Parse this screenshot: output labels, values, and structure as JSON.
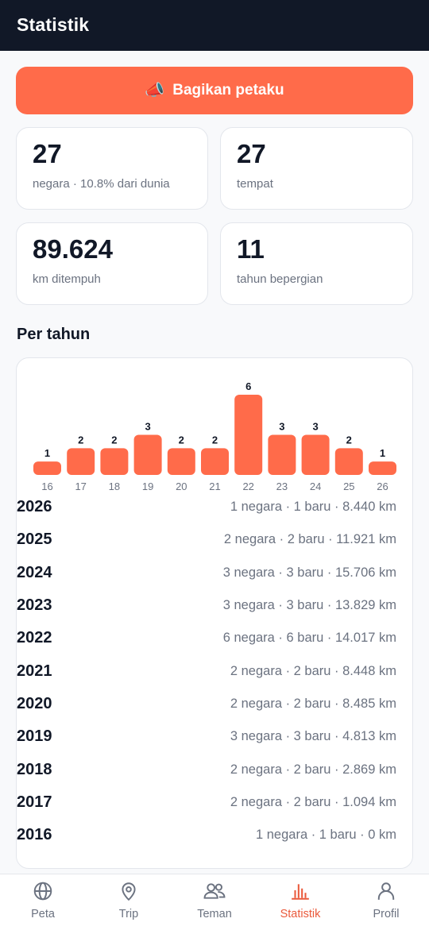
{
  "header": {
    "title": "Statistik"
  },
  "share_button": {
    "icon": "megaphone-icon",
    "label": "Bagikan petaku"
  },
  "stats": [
    {
      "value": "27",
      "label": "negara · 10.8% dari dunia"
    },
    {
      "value": "27",
      "label": "tempat"
    },
    {
      "value": "89.624",
      "label": "km ditempuh"
    },
    {
      "value": "11",
      "label": "tahun bepergian"
    }
  ],
  "per_year": {
    "title": "Per tahun",
    "rows": [
      {
        "year": "2026",
        "info": "1 negara · 1 baru · 8.440 km"
      },
      {
        "year": "2025",
        "info": "2 negara · 2 baru · 11.921 km"
      },
      {
        "year": "2024",
        "info": "3 negara · 3 baru · 15.706 km"
      },
      {
        "year": "2023",
        "info": "3 negara · 3 baru · 13.829 km"
      },
      {
        "year": "2022",
        "info": "6 negara · 6 baru · 14.017 km"
      },
      {
        "year": "2021",
        "info": "2 negara · 2 baru · 8.448 km"
      },
      {
        "year": "2020",
        "info": "2 negara · 2 baru · 8.485 km"
      },
      {
        "year": "2019",
        "info": "3 negara · 3 baru · 4.813 km"
      },
      {
        "year": "2018",
        "info": "2 negara · 2 baru · 2.869 km"
      },
      {
        "year": "2017",
        "info": "2 negara · 2 baru · 1.094 km"
      },
      {
        "year": "2016",
        "info": "1 negara · 1 baru · 0 km"
      }
    ]
  },
  "chart_data": {
    "type": "bar",
    "categories": [
      "16",
      "17",
      "18",
      "19",
      "20",
      "21",
      "22",
      "23",
      "24",
      "25",
      "26"
    ],
    "values": [
      1,
      2,
      2,
      3,
      2,
      2,
      6,
      3,
      3,
      2,
      1
    ],
    "color": "#ff6b4a",
    "ylim": [
      0,
      6
    ]
  },
  "nav": {
    "items": [
      {
        "label": "Peta",
        "icon": "globe-icon",
        "active": false
      },
      {
        "label": "Trip",
        "icon": "map-pin-icon",
        "active": false
      },
      {
        "label": "Teman",
        "icon": "users-icon",
        "active": false
      },
      {
        "label": "Statistik",
        "icon": "bar-chart-icon",
        "active": true
      },
      {
        "label": "Profil",
        "icon": "user-icon",
        "active": false
      }
    ],
    "active_color": "#ea5a3c"
  }
}
